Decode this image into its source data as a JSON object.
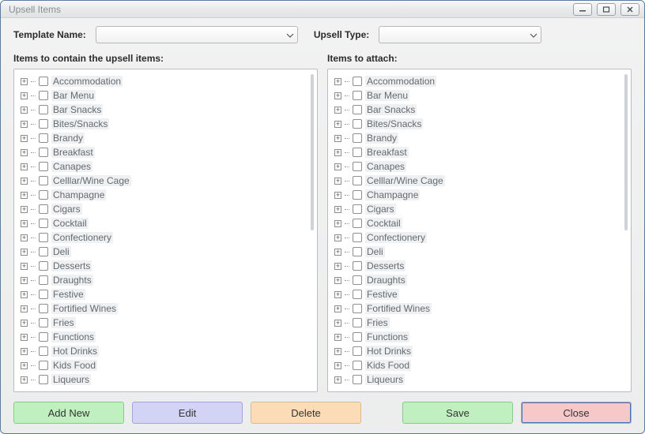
{
  "window": {
    "title": "Upsell Items"
  },
  "form": {
    "template_label": "Template Name:",
    "upsell_type_label": "Upsell Type:",
    "template_value": "",
    "upsell_type_value": ""
  },
  "headers": {
    "left": "Items to contain the upsell items:",
    "right": "Items to attach:"
  },
  "categories": [
    "Accommodation",
    "Bar Menu",
    "Bar Snacks",
    "Bites/Snacks",
    "Brandy",
    "Breakfast",
    "Canapes",
    "Celllar/Wine Cage",
    "Champagne",
    "Cigars",
    "Cocktail",
    "Confectionery",
    "Deli",
    "Desserts",
    "Draughts",
    "Festive",
    "Fortified Wines",
    "Fries",
    "Functions",
    "Hot Drinks",
    "Kids Food",
    "Liqueurs"
  ],
  "buttons": {
    "add_new": "Add New",
    "edit": "Edit",
    "delete": "Delete",
    "save": "Save",
    "close": "Close"
  }
}
